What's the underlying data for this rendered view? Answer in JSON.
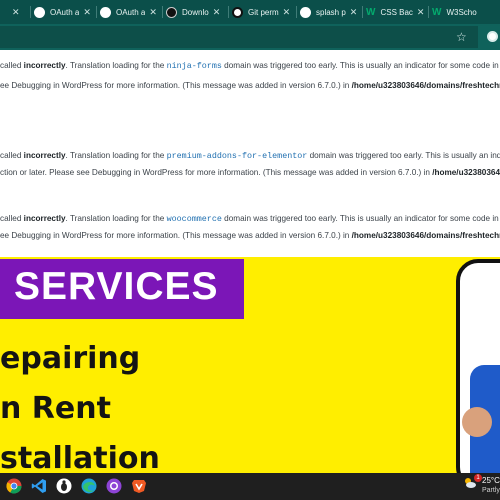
{
  "browser": {
    "tabs": [
      {
        "label": "OAuth a",
        "icon": "github-icon"
      },
      {
        "label": "OAuth a",
        "icon": "github-icon"
      },
      {
        "label": "Downlo",
        "icon": "github-icon"
      },
      {
        "label": "Git perm",
        "icon": "chatgpt-icon"
      },
      {
        "label": "splash p",
        "icon": "google-icon"
      },
      {
        "label": "CSS Bac",
        "icon": "w3schools-icon"
      },
      {
        "label": "W3Scho",
        "icon": "w3schools-icon"
      }
    ],
    "bookmark_icon": "star-icon",
    "profile_icon": "profile-icon"
  },
  "notices": [
    {
      "line1": {
        "pre": "called ",
        "strong": "incorrectly",
        "mid": ". Translation loading for the ",
        "code": "ninja-forms",
        "post": " domain was triggered too early. This is usually an indicator for some code in th"
      },
      "line2": {
        "pre": "ee Debugging in WordPress for more information. (This message was added in version 6.7.0.) in ",
        "strong": "/home/u323803646/domains/freshtechro"
      }
    },
    {
      "line1": {
        "pre": "called ",
        "strong": "incorrectly",
        "mid": ". Translation loading for the ",
        "code": "premium-addons-for-elementor",
        "post": " domain was triggered too early. This is usually an indic"
      },
      "line2": {
        "pre": "ction or later. Please see Debugging in WordPress for more information. (This message was added in version 6.7.0.) in ",
        "strong": "/home/u323803646/"
      }
    },
    {
      "line1": {
        "pre": "called ",
        "strong": "incorrectly",
        "mid": ". Translation loading for the ",
        "code": "woocommerce",
        "post": " domain was triggered too early. This is usually an indicator for some code in th"
      },
      "line2": {
        "pre": "ee Debugging in WordPress for more information. (This message was added in version 6.7.0.) in ",
        "strong": "/home/u323803646/domains/freshtechro"
      }
    }
  ],
  "banner": {
    "title": "SERVICES",
    "lines": [
      "epairing",
      "n Rent",
      "stallation"
    ],
    "colors": {
      "background": "#ffee00",
      "title_box": "#7b16b7"
    }
  },
  "taskbar": {
    "apps": [
      "chrome-icon",
      "vscode-icon",
      "ollama-icon",
      "edge-icon",
      "github-desktop-icon",
      "brave-icon"
    ],
    "weather": {
      "temp": "25°C",
      "condition": "Partly",
      "badge": "1"
    }
  }
}
